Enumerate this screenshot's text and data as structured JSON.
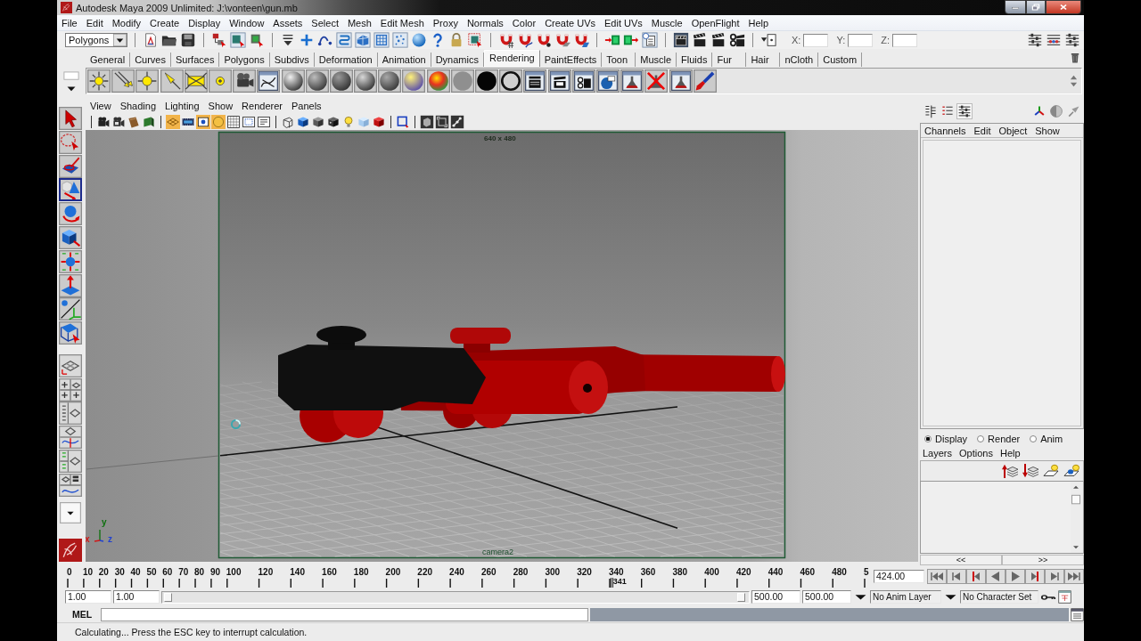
{
  "window": {
    "title": "Autodesk Maya 2009 Unlimited: J:\\vonteen\\gun.mb"
  },
  "menu_bar": [
    "File",
    "Edit",
    "Modify",
    "Create",
    "Display",
    "Window",
    "Assets",
    "Select",
    "Mesh",
    "Edit Mesh",
    "Proxy",
    "Normals",
    "Color",
    "Create UVs",
    "Edit UVs",
    "Muscle",
    "OpenFlight",
    "Help"
  ],
  "status_line": {
    "menu_set": "Polygons",
    "coordinate_labels": [
      "X:",
      "Y:",
      "Z:"
    ]
  },
  "shelf": {
    "tabs": [
      {
        "label": "General",
        "selected": false
      },
      {
        "label": "Curves",
        "selected": false
      },
      {
        "label": "Surfaces",
        "selected": false
      },
      {
        "label": "Polygons",
        "selected": false
      },
      {
        "label": "Subdivs",
        "selected": false
      },
      {
        "label": "Deformation",
        "selected": false
      },
      {
        "label": "Animation",
        "selected": false
      },
      {
        "label": "Dynamics",
        "selected": false
      },
      {
        "label": "Rendering",
        "selected": true
      },
      {
        "label": "PaintEffects",
        "selected": false
      },
      {
        "label": "Toon",
        "selected": false
      },
      {
        "label": "Muscle",
        "selected": false
      },
      {
        "label": "Fluids",
        "selected": false
      },
      {
        "label": "Fur",
        "selected": false
      },
      {
        "label": "Hair",
        "selected": false
      },
      {
        "label": "nCloth",
        "selected": false
      },
      {
        "label": "Custom",
        "selected": false
      }
    ]
  },
  "toolbox": {
    "tools": [
      {
        "selected": false
      },
      {
        "selected": false
      },
      {
        "selected": false
      },
      {
        "selected": true
      },
      {
        "selected": false
      },
      {
        "selected": false
      },
      {
        "selected": false
      },
      {
        "selected": false
      },
      {
        "selected": false
      },
      {
        "selected": false
      }
    ]
  },
  "viewport": {
    "menus": [
      "View",
      "Shading",
      "Lighting",
      "Show",
      "Renderer",
      "Panels"
    ],
    "toolbar": [
      {
        "on": false
      },
      {
        "on": false
      },
      {
        "on": false
      },
      {
        "on": false
      },
      {
        "on": true
      },
      {
        "on": false
      },
      {
        "on": true
      },
      {
        "on": true
      },
      {
        "on": false
      },
      {
        "on": false
      },
      {
        "on": false
      },
      {
        "on": false
      },
      {
        "on": false
      },
      {
        "on": false
      },
      {
        "on": false
      },
      {
        "on": false
      },
      {
        "on": false
      },
      {
        "on": false
      },
      {
        "on": false
      },
      {
        "on": false
      },
      {
        "on": false
      },
      {
        "on": false
      }
    ],
    "resolution_label": "640 x 480",
    "camera_label": "camera2",
    "axis_labels": [
      {
        "label": "y",
        "color": "#0c700c"
      },
      {
        "label": "x",
        "color": "#d01818"
      },
      {
        "label": "z",
        "color": "#2040d0"
      }
    ]
  },
  "channel_box": {
    "menus": [
      "Channels",
      "Edit",
      "Object",
      "Show"
    ]
  },
  "layer_editor": {
    "modes": [
      {
        "label": "Display",
        "selected": true
      },
      {
        "label": "Render",
        "selected": false
      },
      {
        "label": "Anim",
        "selected": false
      }
    ],
    "menus": [
      "Layers",
      "Options",
      "Help"
    ],
    "pager": [
      "<<",
      ">>"
    ]
  },
  "time_slider": {
    "ticks": [
      "0",
      "10",
      "20",
      "30",
      "40",
      "50",
      "60",
      "70",
      "80",
      "90",
      "100",
      "120",
      "140",
      "160",
      "180",
      "200",
      "220",
      "240",
      "260",
      "280",
      "300",
      "320",
      "340",
      "360",
      "380",
      "400",
      "420",
      "440",
      "460",
      "480",
      "5"
    ],
    "current_frame": "341",
    "current_time": "424.00"
  },
  "range_slider": {
    "start_time": "1.00",
    "playback_start": "1.00",
    "playback_end": "500.00",
    "end_time": "500.00",
    "anim_layer": "No Anim Layer",
    "character_set": "No Character Set"
  },
  "command_line": {
    "language": "MEL"
  },
  "help_line": "Calculating... Press the ESC key to interrupt calculation."
}
